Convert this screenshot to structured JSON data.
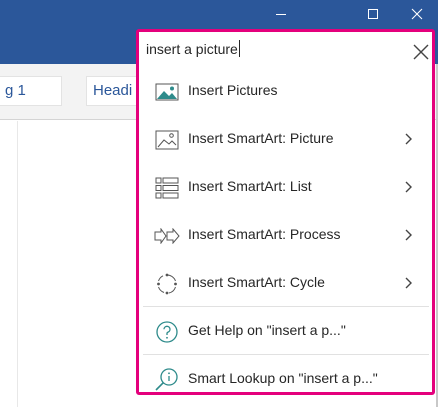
{
  "ribbon": {
    "style_1": "g 1",
    "style_2": "Headi"
  },
  "tell_me": {
    "query": "insert a picture",
    "items": [
      {
        "label": "Insert Pictures",
        "icon": "picture-icon",
        "has_submenu": false
      },
      {
        "label": "Insert SmartArt: Picture",
        "icon": "smartart-picture-icon",
        "has_submenu": true
      },
      {
        "label": "Insert SmartArt: List",
        "icon": "smartart-list-icon",
        "has_submenu": true
      },
      {
        "label": "Insert SmartArt: Process",
        "icon": "smartart-process-icon",
        "has_submenu": true
      },
      {
        "label": "Insert SmartArt: Cycle",
        "icon": "smartart-cycle-icon",
        "has_submenu": true
      }
    ],
    "help_label": "Get Help on \"insert a p...\"",
    "lookup_label": "Smart Lookup on \"insert a p...\""
  },
  "colors": {
    "title_bar": "#2b579a",
    "highlight_border": "#e4007c",
    "icon_teal": "#2e8b8b"
  }
}
